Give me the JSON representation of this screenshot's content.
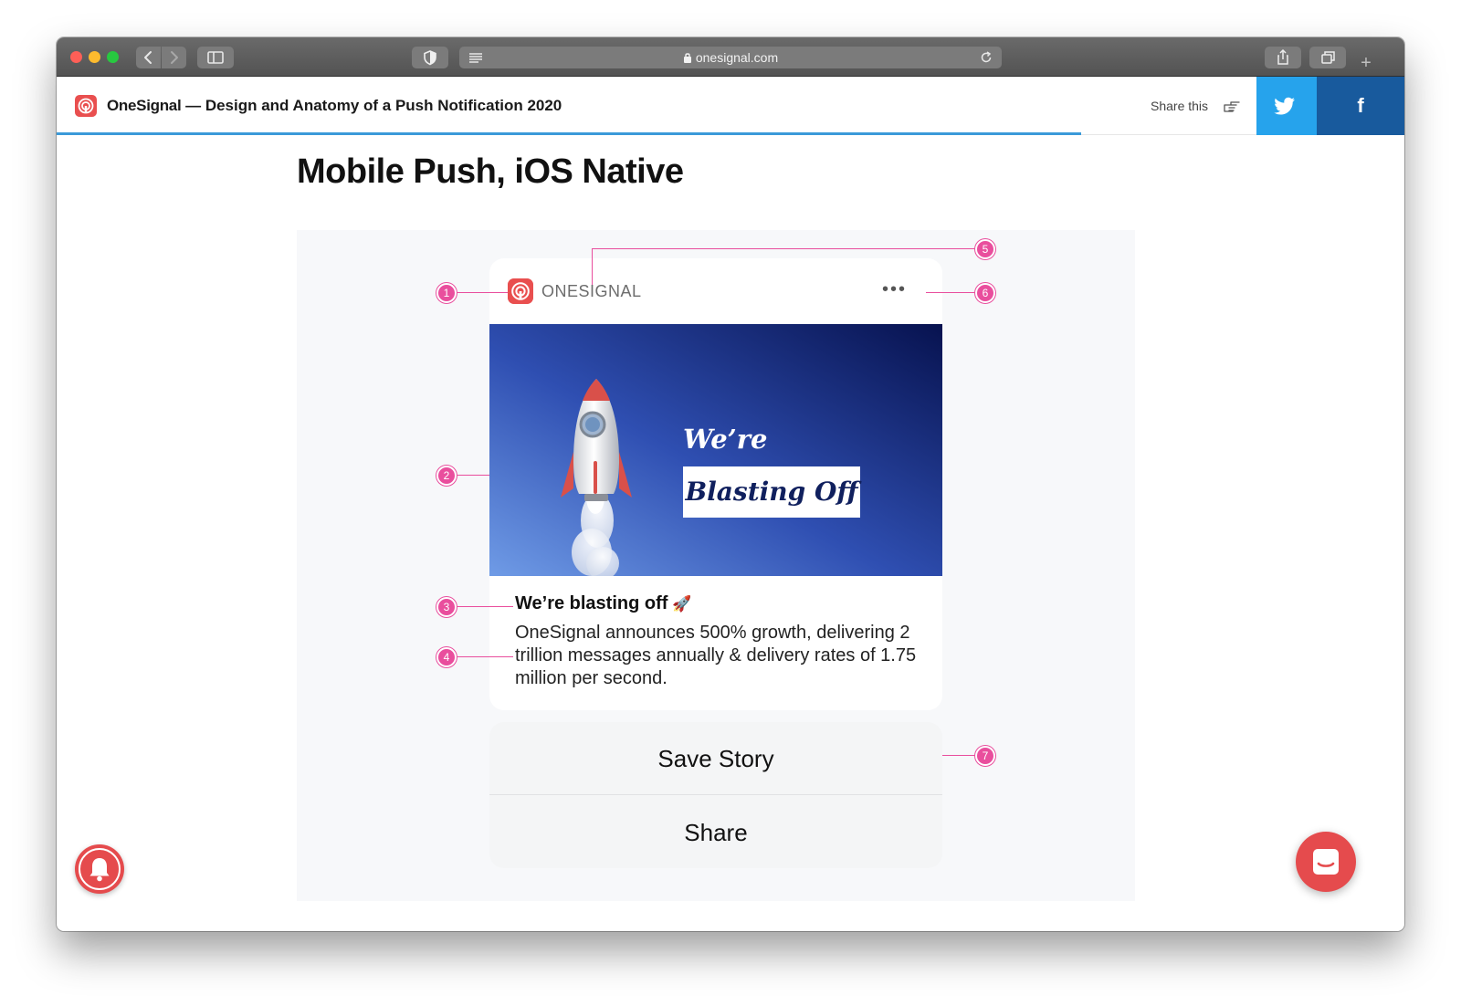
{
  "browser": {
    "url": "onesignal.com",
    "new_tab_label": "+"
  },
  "header": {
    "brand": "OneSignal",
    "title": " — Design and Anatomy of a Push Notification 2020",
    "share_label": "Share this",
    "facebook_label": "f",
    "reading_progress": 0.76
  },
  "page": {
    "title": "Mobile Push, iOS Native"
  },
  "notification": {
    "app_name": "ONESIGNAL",
    "more_label": "•••",
    "image_text_1": "We’re",
    "image_text_2": "Blasting Off",
    "title": "We’re blasting off",
    "title_emoji": "🚀",
    "body": "OneSignal announces 500% growth, delivering 2 trillion messages annually & delivery rates of 1.75 million per second."
  },
  "actions": {
    "save": "Save Story",
    "share": "Share"
  },
  "callouts": [
    "1",
    "2",
    "3",
    "4",
    "5",
    "6",
    "7"
  ],
  "colors": {
    "brand_red": "#e94f4f",
    "callout_pink": "#e94e9d",
    "twitter_blue": "#26a3ec",
    "facebook_blue": "#185a9d",
    "progress_blue": "#3a9ad9"
  },
  "icons": {
    "bell": "bell-icon",
    "chat": "chat-icon",
    "twitter": "twitter-bird-icon",
    "share_hand": "pointing-hand-icon"
  }
}
